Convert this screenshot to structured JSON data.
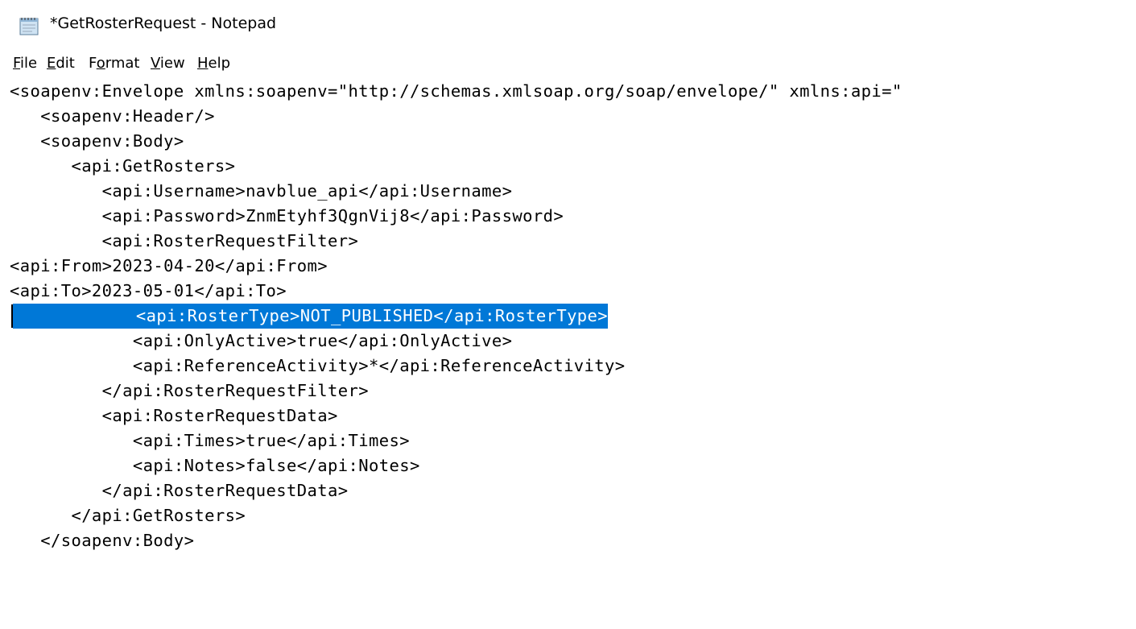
{
  "window": {
    "title": "*GetRosterRequest - Notepad",
    "app_icon": "notepad-icon"
  },
  "menu": {
    "items": [
      {
        "pre": "",
        "mnemonic": "F",
        "post": "ile"
      },
      {
        "pre": "",
        "mnemonic": "E",
        "post": "dit"
      },
      {
        "pre": "F",
        "mnemonic": "o",
        "post": "rmat"
      },
      {
        "pre": "",
        "mnemonic": "V",
        "post": "iew"
      },
      {
        "pre": "",
        "mnemonic": "H",
        "post": "elp"
      }
    ]
  },
  "editor": {
    "selected_line_index": 9,
    "lines": [
      "<soapenv:Envelope xmlns:soapenv=\"http://schemas.xmlsoap.org/soap/envelope/\" xmlns:api=\"",
      "   <soapenv:Header/>",
      "   <soapenv:Body>",
      "      <api:GetRosters>",
      "         <api:Username>navblue_api</api:Username>",
      "         <api:Password>ZnmEtyhf3QgnVij8</api:Password>",
      "         <api:RosterRequestFilter>",
      "<api:From>2023-04-20</api:From>",
      "<api:To>2023-05-01</api:To>",
      "            <api:RosterType>NOT_PUBLISHED</api:RosterType>",
      "            <api:OnlyActive>true</api:OnlyActive>",
      "            <api:ReferenceActivity>*</api:ReferenceActivity>",
      "         </api:RosterRequestFilter>",
      "         <api:RosterRequestData>",
      "            <api:Times>true</api:Times>",
      "            <api:Notes>false</api:Notes>",
      "         </api:RosterRequestData>",
      "      </api:GetRosters>",
      "   </soapenv:Body>"
    ]
  }
}
